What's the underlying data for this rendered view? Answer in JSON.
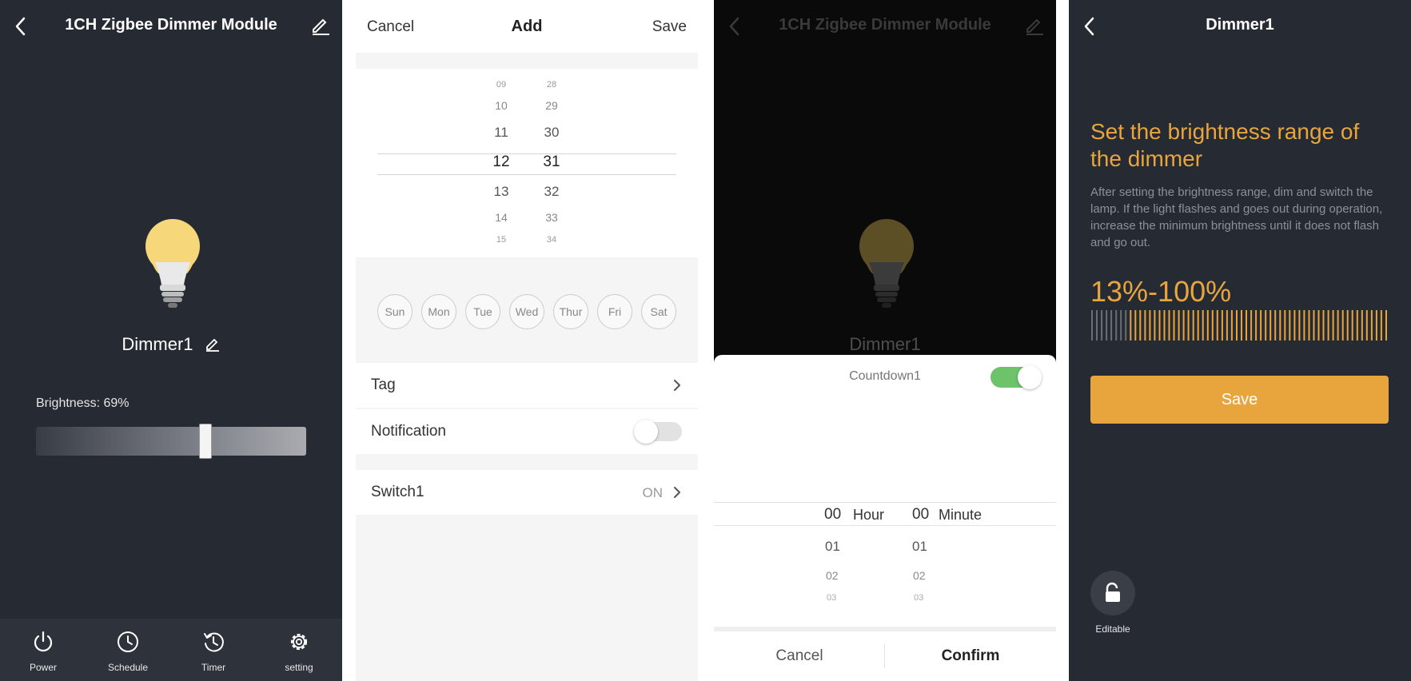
{
  "screen1": {
    "title": "1CH Zigbee Dimmer Module",
    "device_name": "Dimmer1",
    "brightness_label": "Brightness: 69%",
    "brightness_value": 0.69,
    "nav": [
      "Power",
      "Schedule",
      "Timer",
      "setting"
    ]
  },
  "screen2": {
    "cancel": "Cancel",
    "title": "Add",
    "save": "Save",
    "hours": [
      "09",
      "10",
      "11",
      "12",
      "13",
      "14",
      "15"
    ],
    "minutes": [
      "28",
      "29",
      "30",
      "31",
      "32",
      "33",
      "34"
    ],
    "days": [
      "Sun",
      "Mon",
      "Tue",
      "Wed",
      "Thur",
      "Fri",
      "Sat"
    ],
    "tag_label": "Tag",
    "notification_label": "Notification",
    "switch_label": "Switch1",
    "switch_value": "ON"
  },
  "screen3": {
    "title": "1CH Zigbee Dimmer Module",
    "device_name": "Dimmer1",
    "sheet_title": "Countdown1",
    "hours": [
      "00",
      "01",
      "02",
      "03"
    ],
    "minutes": [
      "00",
      "01",
      "02",
      "03"
    ],
    "hour_unit": "Hour",
    "minute_unit": "Minute",
    "cancel": "Cancel",
    "confirm": "Confirm"
  },
  "screen4": {
    "title": "Dimmer1",
    "heading": "Set the brightness range of the dimmer",
    "description": "After setting the brightness range, dim and switch the lamp. If the light flashes and goes out during operation, increase the minimum brightness until it does not flash and go out.",
    "range": "13%-100%",
    "range_min": 13,
    "range_max": 100,
    "save": "Save",
    "lock_label": "Editable"
  },
  "colors": {
    "dark_bg": "#262a33",
    "accent_orange": "#e8a53e",
    "toggle_green": "#6cc36a",
    "bulb_yellow": "#f6d77a"
  }
}
